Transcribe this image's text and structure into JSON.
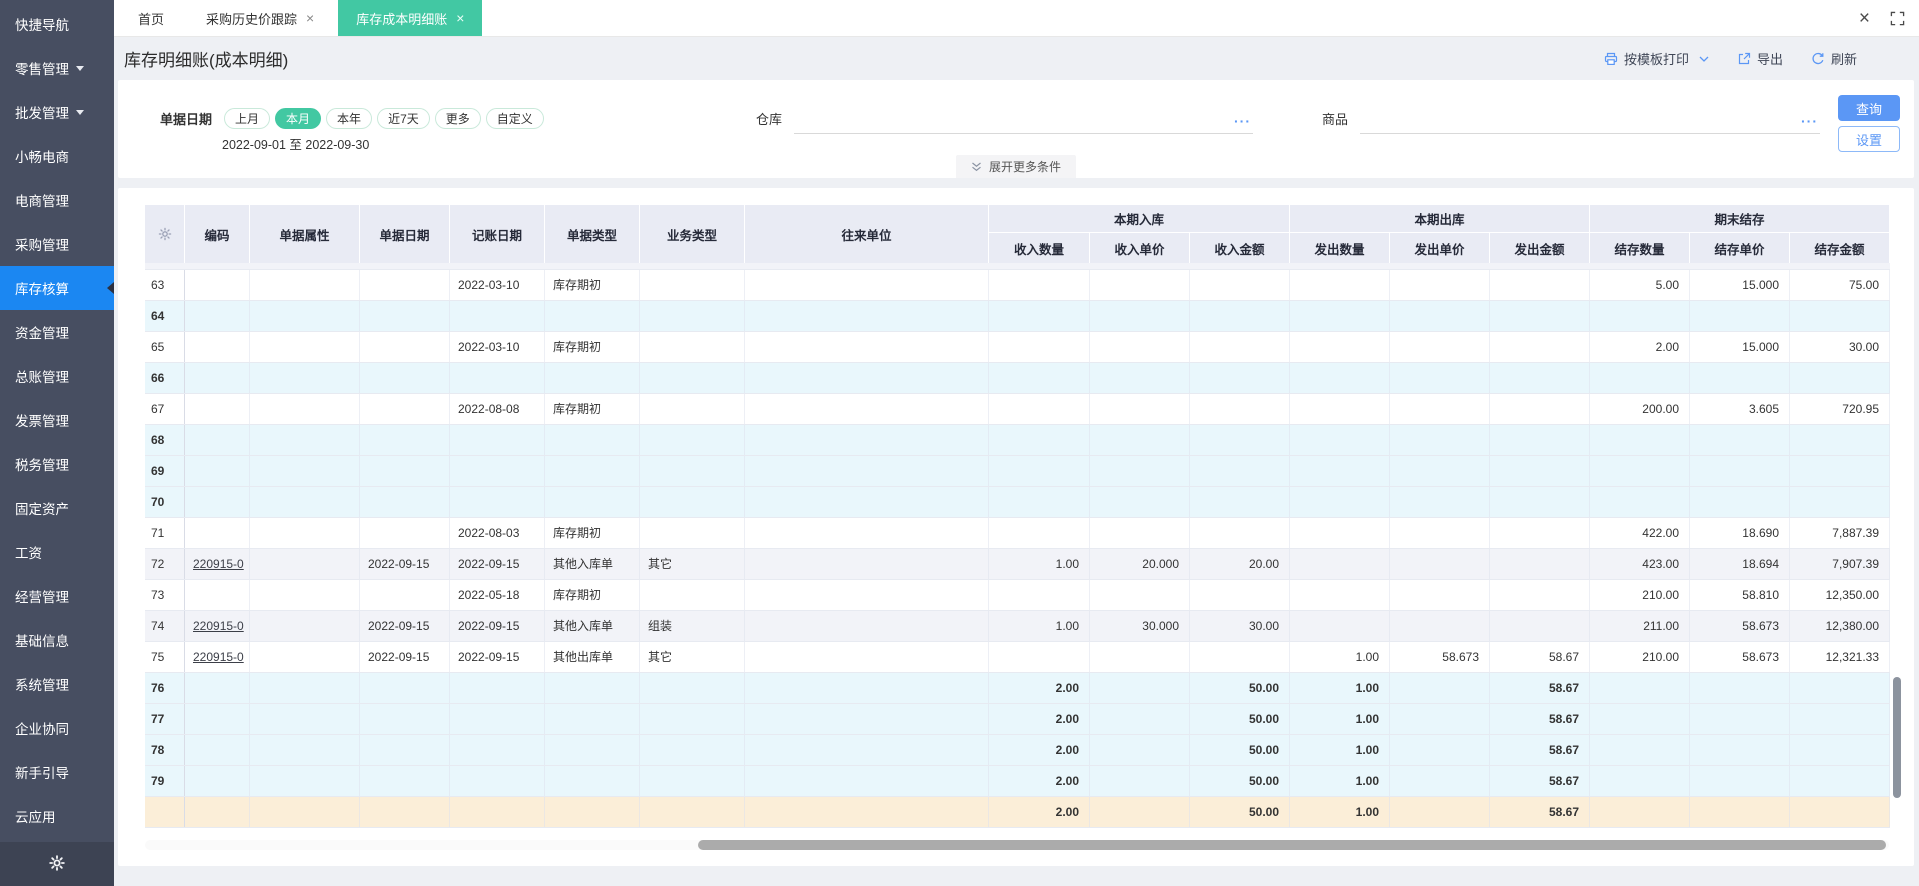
{
  "ui": {
    "close_glyph": "×",
    "ellipsis": "···"
  },
  "sidebar": {
    "items": [
      {
        "label": "快捷导航"
      },
      {
        "label": "零售管理",
        "has_arrow": true
      },
      {
        "label": "批发管理",
        "has_arrow": true
      },
      {
        "label": "小畅电商"
      },
      {
        "label": "电商管理"
      },
      {
        "label": "采购管理"
      },
      {
        "label": "库存核算",
        "active": true
      },
      {
        "label": "资金管理"
      },
      {
        "label": "总账管理"
      },
      {
        "label": "发票管理"
      },
      {
        "label": "税务管理"
      },
      {
        "label": "固定资产"
      },
      {
        "label": "工资"
      },
      {
        "label": "经营管理"
      },
      {
        "label": "基础信息"
      },
      {
        "label": "系统管理"
      },
      {
        "label": "企业协同"
      },
      {
        "label": "新手引导"
      },
      {
        "label": "云应用"
      }
    ]
  },
  "tabs": [
    {
      "label": "首页",
      "closable": false,
      "active": false
    },
    {
      "label": "采购历史价跟踪",
      "closable": true,
      "active": false
    },
    {
      "label": "库存成本明细账",
      "closable": true,
      "active": true
    }
  ],
  "page": {
    "title": "库存明细账(成本明细)",
    "actions": {
      "print": "按模板打印",
      "export": "导出",
      "refresh": "刷新"
    }
  },
  "filters": {
    "date_label": "单据日期",
    "pills": [
      {
        "label": "上月"
      },
      {
        "label": "本月",
        "active": true
      },
      {
        "label": "本年"
      },
      {
        "label": "近7天"
      },
      {
        "label": "更多"
      },
      {
        "label": "自定义"
      }
    ],
    "date_range": "2022-09-01 至 2022-09-30",
    "warehouse_label": "仓库",
    "product_label": "商品",
    "search_button": "查询",
    "settings_button": "设置",
    "expand_more": "展开更多条件"
  },
  "table": {
    "columns": [
      "编码",
      "单据属性",
      "单据日期",
      "记账日期",
      "单据类型",
      "业务类型",
      "往来单位"
    ],
    "groups": [
      {
        "label": "本期入库",
        "children": [
          "收入数量",
          "收入单价",
          "收入金额"
        ]
      },
      {
        "label": "本期出库",
        "children": [
          "发出数量",
          "发出单价",
          "发出金额"
        ]
      },
      {
        "label": "期末结存",
        "children": [
          "结存数量",
          "结存单价",
          "结存金额"
        ]
      }
    ],
    "rows": [
      {
        "v": "sliver",
        "cells": [
          "",
          "",
          "",
          "",
          "",
          "",
          "",
          "",
          "",
          "",
          "",
          "",
          "",
          "",
          "",
          "",
          ""
        ]
      },
      {
        "v": "white",
        "cells": [
          "63",
          "",
          "",
          "",
          "2022-03-10",
          "库存期初",
          "",
          "",
          "",
          "",
          "",
          "",
          "",
          "",
          "5.00",
          "15.000",
          "75.00"
        ]
      },
      {
        "v": "summary",
        "cells": [
          "64",
          "",
          "",
          "",
          "",
          "",
          "",
          "",
          "",
          "",
          "",
          "",
          "",
          "",
          "",
          "",
          ""
        ]
      },
      {
        "v": "white",
        "cells": [
          "65",
          "",
          "",
          "",
          "2022-03-10",
          "库存期初",
          "",
          "",
          "",
          "",
          "",
          "",
          "",
          "",
          "2.00",
          "15.000",
          "30.00"
        ]
      },
      {
        "v": "summary",
        "cells": [
          "66",
          "",
          "",
          "",
          "",
          "",
          "",
          "",
          "",
          "",
          "",
          "",
          "",
          "",
          "",
          "",
          ""
        ]
      },
      {
        "v": "white",
        "cells": [
          "67",
          "",
          "",
          "",
          "2022-08-08",
          "库存期初",
          "",
          "",
          "",
          "",
          "",
          "",
          "",
          "",
          "200.00",
          "3.605",
          "720.95"
        ]
      },
      {
        "v": "summary",
        "cells": [
          "68",
          "",
          "",
          "",
          "",
          "",
          "",
          "",
          "",
          "",
          "",
          "",
          "",
          "",
          "",
          "",
          ""
        ]
      },
      {
        "v": "summary",
        "cells": [
          "69",
          "",
          "",
          "",
          "",
          "",
          "",
          "",
          "",
          "",
          "",
          "",
          "",
          "",
          "",
          "",
          ""
        ]
      },
      {
        "v": "summary",
        "cells": [
          "70",
          "",
          "",
          "",
          "",
          "",
          "",
          "",
          "",
          "",
          "",
          "",
          "",
          "",
          "",
          "",
          ""
        ]
      },
      {
        "v": "white",
        "cells": [
          "71",
          "",
          "",
          "",
          "2022-08-03",
          "库存期初",
          "",
          "",
          "",
          "",
          "",
          "",
          "",
          "",
          "422.00",
          "18.690",
          "7,887.39"
        ]
      },
      {
        "v": "stripe",
        "link": true,
        "cells": [
          "72",
          "220915-0",
          "",
          "2022-09-15",
          "2022-09-15",
          "其他入库单",
          "其它",
          "",
          "1.00",
          "20.000",
          "20.00",
          "",
          "",
          "",
          "423.00",
          "18.694",
          "7,907.39"
        ]
      },
      {
        "v": "white",
        "cells": [
          "73",
          "",
          "",
          "",
          "2022-05-18",
          "库存期初",
          "",
          "",
          "",
          "",
          "",
          "",
          "",
          "",
          "210.00",
          "58.810",
          "12,350.00"
        ]
      },
      {
        "v": "stripe",
        "link": true,
        "cells": [
          "74",
          "220915-0",
          "",
          "2022-09-15",
          "2022-09-15",
          "其他入库单",
          "组装",
          "",
          "1.00",
          "30.000",
          "30.00",
          "",
          "",
          "",
          "211.00",
          "58.673",
          "12,380.00"
        ]
      },
      {
        "v": "white",
        "link": true,
        "cells": [
          "75",
          "220915-0",
          "",
          "2022-09-15",
          "2022-09-15",
          "其他出库单",
          "其它",
          "",
          "",
          "",
          "",
          "1.00",
          "58.673",
          "58.67",
          "210.00",
          "58.673",
          "12,321.33"
        ]
      },
      {
        "v": "summary",
        "cells": [
          "76",
          "",
          "",
          "",
          "",
          "",
          "",
          "",
          "2.00",
          "",
          "50.00",
          "1.00",
          "",
          "58.67",
          "",
          "",
          ""
        ]
      },
      {
        "v": "summary",
        "cells": [
          "77",
          "",
          "",
          "",
          "",
          "",
          "",
          "",
          "2.00",
          "",
          "50.00",
          "1.00",
          "",
          "58.67",
          "",
          "",
          ""
        ]
      },
      {
        "v": "summary",
        "cells": [
          "78",
          "",
          "",
          "",
          "",
          "",
          "",
          "",
          "2.00",
          "",
          "50.00",
          "1.00",
          "",
          "58.67",
          "",
          "",
          ""
        ]
      },
      {
        "v": "summary",
        "cells": [
          "79",
          "",
          "",
          "",
          "",
          "",
          "",
          "",
          "2.00",
          "",
          "50.00",
          "1.00",
          "",
          "58.67",
          "",
          "",
          ""
        ]
      },
      {
        "v": "total",
        "cells": [
          "",
          "",
          "",
          "",
          "",
          "",
          "",
          "",
          "2.00",
          "",
          "50.00",
          "1.00",
          "",
          "58.67",
          "",
          "",
          ""
        ]
      }
    ]
  }
}
